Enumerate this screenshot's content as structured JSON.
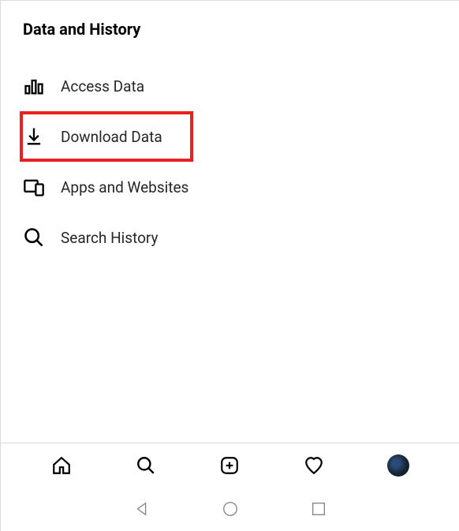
{
  "section": {
    "title": "Data and History",
    "items": [
      {
        "label": "Access Data",
        "icon": "bar-chart-icon",
        "highlighted": false
      },
      {
        "label": "Download Data",
        "icon": "download-icon",
        "highlighted": true
      },
      {
        "label": "Apps and Websites",
        "icon": "apps-icon",
        "highlighted": false
      },
      {
        "label": "Search History",
        "icon": "search-icon",
        "highlighted": false
      }
    ]
  },
  "bottomNav": {
    "home": "Home",
    "search": "Search",
    "newPost": "New Post",
    "activity": "Activity",
    "profile": "Profile"
  },
  "systemNav": {
    "back": "Back",
    "home": "Home",
    "recents": "Recents"
  }
}
